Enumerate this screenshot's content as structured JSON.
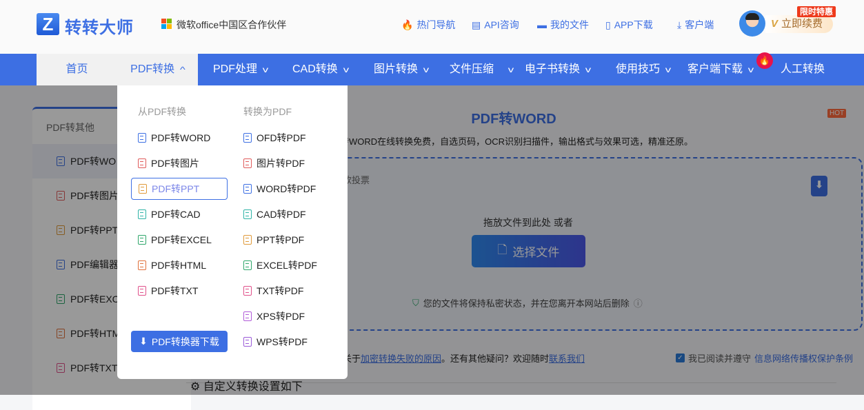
{
  "header": {
    "logo_letter": "Z",
    "logo_text": "转转大师",
    "partner": "微软office中国区合作伙伴",
    "links": [
      "热门导航",
      "API咨询",
      "我的文件",
      "APP下载",
      "客户端"
    ],
    "promo_badge": "限时特惠",
    "renew_label": "立即续费",
    "vip": "V"
  },
  "nav": {
    "items": [
      "首页",
      "PDF转换",
      "PDF处理",
      "CAD转换",
      "图片转换",
      "文件压缩",
      "电子书转换",
      "使用技巧",
      "客户端下载",
      "人工转换"
    ],
    "hot": "HOT"
  },
  "dropdown": {
    "from_title": "从PDF转换",
    "to_title": "转换为PDF",
    "from": [
      "PDF转WORD",
      "PDF转图片",
      "PDF转PPT",
      "PDF转CAD",
      "PDF转EXCEL",
      "PDF转HTML",
      "PDF转TXT"
    ],
    "to": [
      "OFD转PDF",
      "图片转PDF",
      "WORD转PDF",
      "CAD转PDF",
      "PPT转PDF",
      "EXCEL转PDF",
      "TXT转PDF",
      "XPS转PDF",
      "WPS转PDF"
    ],
    "download": "PDF转换器下载",
    "selected": "PDF转PPT"
  },
  "sidebar": {
    "title": "PDF转其他",
    "items": [
      "PDF转WO",
      "PDF转图片",
      "PDF转PPT",
      "PDF编辑器",
      "PDF转EXC",
      "PDF转HTM",
      "PDF转TXT"
    ]
  },
  "main": {
    "title": "PDF转WORD",
    "desc": "转WORD在线转换免费，自选页码，OCR识别扫描件，输出格式与效果可选，精准还原。",
    "vote": "款投票",
    "drop_text": "拖放文件到此处 或者",
    "choose": "选择文件",
    "privacy": "您的文件将保持私密状态，并在您离开本网站后删除",
    "faq_pre": "关于",
    "faq_link1": "加密转换失败的原因",
    "faq_mid": "。还有其他疑问？欢迎随时",
    "faq_link2": "联系我们",
    "agree_pre": "我已阅读并遵守",
    "agree_link": "信息网络传播权保护条例",
    "custom": "自定义转换设置如下"
  },
  "colors": {
    "brand": "#3d6fe3",
    "promo": "#ee3a1c"
  }
}
